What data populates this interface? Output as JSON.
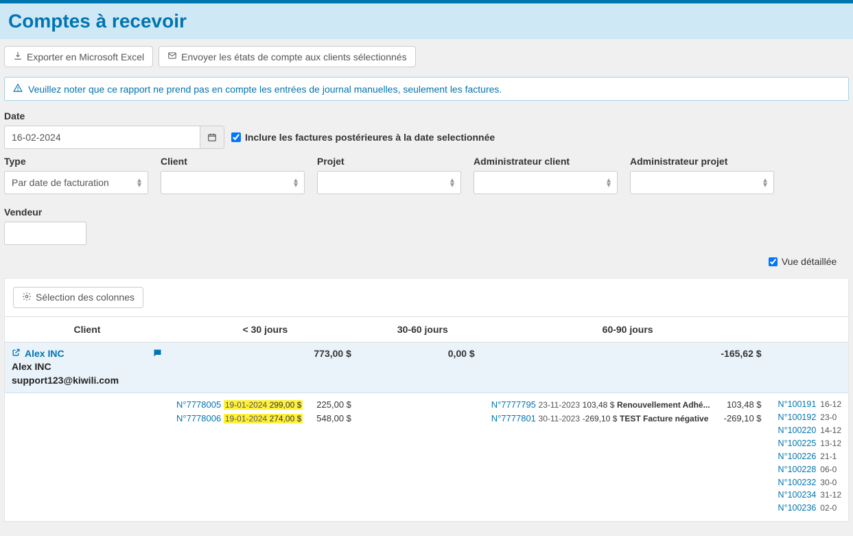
{
  "header": {
    "title": "Comptes à recevoir"
  },
  "toolbar": {
    "export_label": "Exporter en Microsoft Excel",
    "send_label": "Envoyer les états de compte aux clients sélectionnés"
  },
  "alert": {
    "text": "Veuillez noter que ce rapport ne prend pas en compte les entrées de journal manuelles, seulement les factures."
  },
  "filters": {
    "date_label": "Date",
    "date_value": "16-02-2024",
    "include_future_label": "Inclure les factures postérieures à la date selectionnée",
    "type_label": "Type",
    "type_value": "Par date de facturation",
    "client_label": "Client",
    "project_label": "Projet",
    "admin_client_label": "Administrateur client",
    "admin_project_label": "Administrateur projet",
    "vendor_label": "Vendeur"
  },
  "view": {
    "detailed_label": "Vue détaillée"
  },
  "columns_button": "Sélection des colonnes",
  "table": {
    "headers": {
      "client": "Client",
      "lt30": "< 30 jours",
      "d3060": "30-60 jours",
      "d6090": "60-90 jours"
    },
    "client": {
      "name": "Alex INC",
      "legal": "Alex INC",
      "email": "support123@kiwili.com",
      "totals": {
        "lt30": "773,00 $",
        "d3060": "0,00 $",
        "d6090": "-165,62 $"
      }
    },
    "details": {
      "lt30": [
        {
          "ref": "N°7778005",
          "date": "19-01-2024",
          "amount": "299,00 $",
          "highlight": true,
          "subtotal": "225,00 $"
        },
        {
          "ref": "N°7778006",
          "date": "19-01-2024",
          "amount": "274,00 $",
          "highlight": true,
          "subtotal": "548,00 $"
        }
      ],
      "d6090": [
        {
          "ref": "N°7777795",
          "date": "23-11-2023",
          "amount": "103,48 $",
          "desc": "Renouvellement Adhé...",
          "subtotal": "103,48 $"
        },
        {
          "ref": "N°7777801",
          "date": "30-11-2023",
          "amount": "-269,10 $",
          "desc": "TEST Facture négative",
          "subtotal": "-269,10 $"
        }
      ],
      "extra": [
        {
          "ref": "N°100191",
          "date": "16-12"
        },
        {
          "ref": "N°100192",
          "date": "23-0"
        },
        {
          "ref": "N°100220",
          "date": "14-12"
        },
        {
          "ref": "N°100225",
          "date": "13-12"
        },
        {
          "ref": "N°100226",
          "date": "21-1"
        },
        {
          "ref": "N°100228",
          "date": "06-0"
        },
        {
          "ref": "N°100232",
          "date": "30-0"
        },
        {
          "ref": "N°100234",
          "date": "31-12"
        },
        {
          "ref": "N°100236",
          "date": "02-0"
        }
      ]
    }
  }
}
